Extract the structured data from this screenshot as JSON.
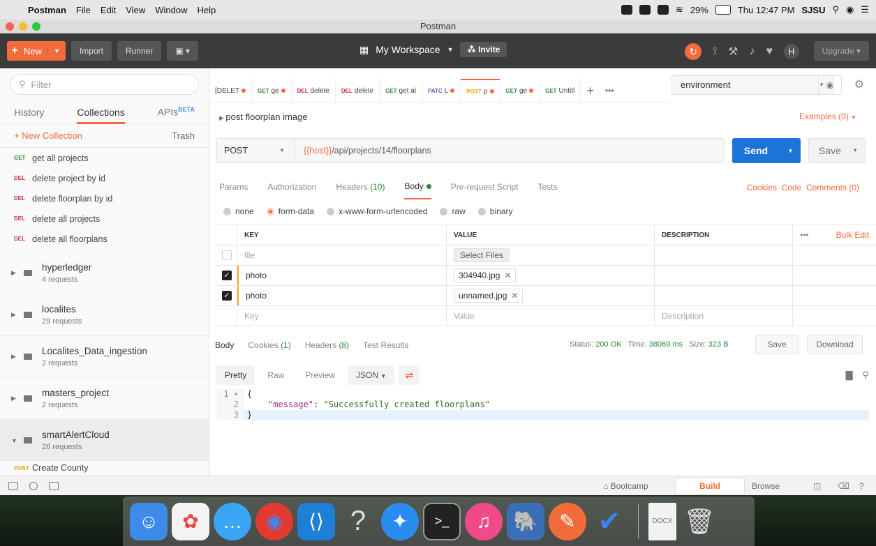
{
  "menubar": {
    "app": "Postman",
    "items": [
      "File",
      "Edit",
      "View",
      "Window",
      "Help"
    ],
    "battery": "29%",
    "clock": "Thu 12:47 PM",
    "user": "SJSU"
  },
  "window": {
    "title": "Postman"
  },
  "header": {
    "new_label": "New",
    "import_label": "Import",
    "runner_label": "Runner",
    "workspace_label": "My Workspace",
    "invite_label": "Invite",
    "upgrade_label": "Upgrade"
  },
  "sidebar": {
    "filter_placeholder": "Filter",
    "tabs": {
      "history": "History",
      "collections": "Collections",
      "apis": "APIs",
      "beta": "BETA"
    },
    "new_collection": "+ New Collection",
    "trash": "Trash",
    "requests": [
      {
        "method": "GET",
        "name": "get all projects"
      },
      {
        "method": "DEL",
        "name": "delete project by id"
      },
      {
        "method": "DEL",
        "name": "delete floorplan by id"
      },
      {
        "method": "DEL",
        "name": "delete all projects"
      },
      {
        "method": "DEL",
        "name": "delete all floorplans"
      }
    ],
    "folders": [
      {
        "name": "hyperledger",
        "count": "4 requests"
      },
      {
        "name": "localites",
        "count": "29 requests"
      },
      {
        "name": "Localites_Data_ingestion",
        "count": "2 requests"
      },
      {
        "name": "masters_project",
        "count": "2 requests"
      },
      {
        "name": "smartAlertCloud",
        "count": "26 requests"
      }
    ],
    "last_request": {
      "method": "POST",
      "name": "Create County"
    }
  },
  "tabs": [
    {
      "method": "",
      "name": "[DELET"
    },
    {
      "method": "GET",
      "name": "ge"
    },
    {
      "method": "DEL",
      "name": "delete"
    },
    {
      "method": "DEL",
      "name": "delete"
    },
    {
      "method": "GET",
      "name": "get al"
    },
    {
      "method": "PATC",
      "name": "L"
    },
    {
      "method": "POST",
      "name": "p"
    },
    {
      "method": "GET",
      "name": "ge"
    },
    {
      "method": "GET",
      "name": "Untitl"
    }
  ],
  "environment": {
    "selected": "environment"
  },
  "request": {
    "name": "post floorplan image",
    "examples": "Examples (0)",
    "method": "POST",
    "url_var": "{{host}}",
    "url_path": "/api/projects/14/floorplans",
    "send_label": "Send",
    "save_label": "Save"
  },
  "subtabs": {
    "params": "Params",
    "authorization": "Authorization",
    "headers": "Headers",
    "headers_count": "(10)",
    "body": "Body",
    "prerequest": "Pre-request Script",
    "tests": "Tests",
    "cookies": "Cookies",
    "code": "Code",
    "comments": "Comments (0)"
  },
  "body_modes": [
    "none",
    "form-data",
    "x-www-form-urlencoded",
    "raw",
    "binary"
  ],
  "kv": {
    "headers": {
      "key": "KEY",
      "value": "VALUE",
      "description": "DESCRIPTION",
      "more": "•••",
      "bulk": "Bulk Edit"
    },
    "rows": [
      {
        "key": "file",
        "value": "Select Files",
        "checked": false
      },
      {
        "key": "photo",
        "value": "304940.jpg",
        "checked": true
      },
      {
        "key": "photo",
        "value": "unnamed.jpg",
        "checked": true
      }
    ],
    "placeholder": {
      "key": "Key",
      "value": "Value",
      "description": "Description"
    }
  },
  "response": {
    "tabs": {
      "body": "Body",
      "cookies": "Cookies",
      "cookies_count": "(1)",
      "headers": "Headers",
      "headers_count": "(8)",
      "tests": "Test Results"
    },
    "status_label": "Status:",
    "status_value": "200 OK",
    "time_label": "Time:",
    "time_value": "38069 ms",
    "size_label": "Size:",
    "size_value": "323 B",
    "save_label": "Save",
    "download_label": "Download",
    "views": {
      "pretty": "Pretty",
      "raw": "Raw",
      "preview": "Preview",
      "format": "JSON"
    },
    "code": {
      "l1": "1",
      "l2": "2",
      "l3": "3",
      "open": "{",
      "key": "\"message\"",
      "colon": ": ",
      "value": "\"Successfully created floorplans\"",
      "close": "}"
    }
  },
  "statusbar": {
    "bootcamp": "Bootcamp",
    "build": "Build",
    "browse": "Browse"
  }
}
